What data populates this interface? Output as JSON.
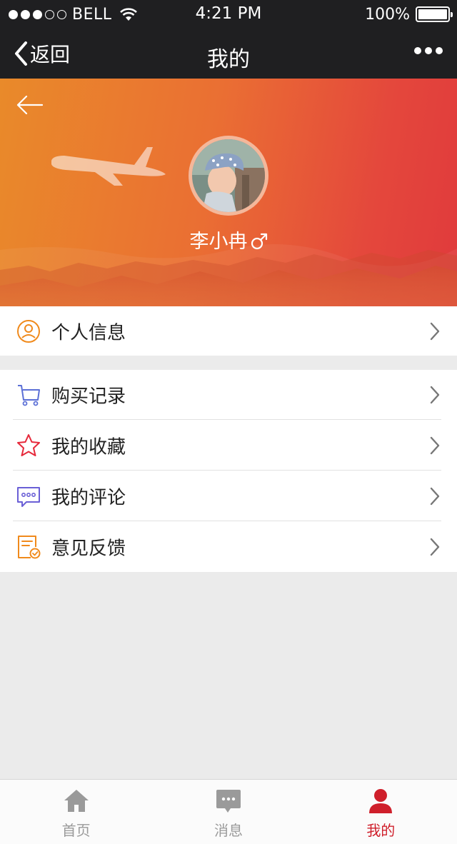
{
  "status_bar": {
    "carrier": "BELL",
    "time": "4:21 PM",
    "battery": "100%",
    "signal_dots_filled": 3,
    "signal_dots_total": 5
  },
  "nav": {
    "back_label": "返回",
    "title": "我的"
  },
  "profile": {
    "name": "李小冉",
    "gender_icon": "male-symbol-icon"
  },
  "menu_primary": [
    {
      "label": "个人信息",
      "icon": "user-circle-icon",
      "icon_color": "#f08a1c"
    }
  ],
  "menu_secondary": [
    {
      "label": "购买记录",
      "icon": "cart-icon",
      "icon_color": "#5b6fd6"
    },
    {
      "label": "我的收藏",
      "icon": "star-icon",
      "icon_color": "#e6283a"
    },
    {
      "label": "我的评论",
      "icon": "comment-icon",
      "icon_color": "#6a5fd6"
    },
    {
      "label": "意见反馈",
      "icon": "feedback-icon",
      "icon_color": "#f08a1c"
    }
  ],
  "tabs": [
    {
      "label": "首页",
      "icon": "home-icon",
      "active": false
    },
    {
      "label": "消息",
      "icon": "message-icon",
      "active": false
    },
    {
      "label": "我的",
      "icon": "profile-icon",
      "active": true
    }
  ],
  "colors": {
    "bar_bg": "#1f1f21",
    "accent_active": "#cf1f2b",
    "tab_inactive": "#9a9a9a",
    "hero_start": "#e98a2a",
    "hero_end": "#e03a3c"
  }
}
